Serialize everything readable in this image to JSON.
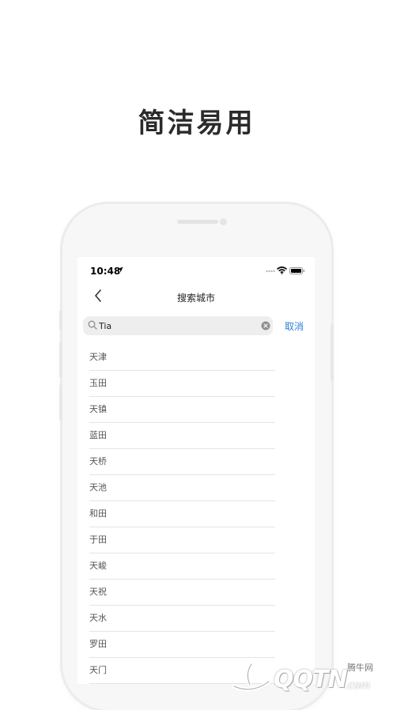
{
  "headline": "简洁易用",
  "status_bar": {
    "time": "10:48"
  },
  "nav": {
    "title": "搜索城市"
  },
  "search": {
    "value": "Tia",
    "cancel_label": "取消"
  },
  "results": [
    "天津",
    "玉田",
    "天镇",
    "蓝田",
    "天桥",
    "天池",
    "和田",
    "于田",
    "天峻",
    "天祝",
    "天水",
    "罗田",
    "天门"
  ],
  "watermark": {
    "brand": "QQTN",
    "cn": "腾牛网",
    "suffix": ".com"
  },
  "colors": {
    "accent": "#2f7fd8",
    "headline": "#2b2b2b"
  }
}
